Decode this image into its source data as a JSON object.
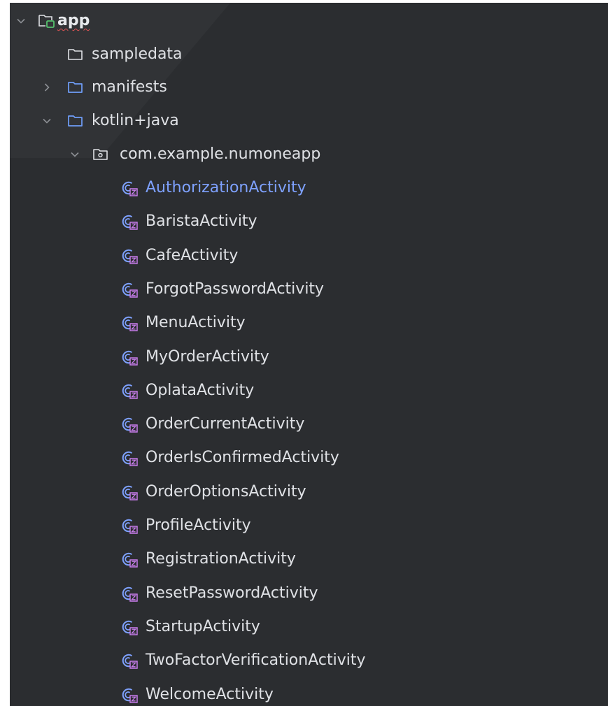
{
  "tree": {
    "root": {
      "label": "app",
      "expanded": true,
      "icon": "android-module-icon"
    },
    "sampledata": {
      "label": "sampledata",
      "icon": "folder-icon"
    },
    "manifests": {
      "label": "manifests",
      "expanded": false,
      "icon": "folder-icon"
    },
    "source_root": {
      "label": "kotlin+java",
      "expanded": true,
      "icon": "source-folder-icon"
    },
    "package": {
      "label": "com.example.numoneapp",
      "expanded": true,
      "icon": "package-icon"
    },
    "classes": [
      {
        "label": "AuthorizationActivity",
        "icon": "kotlin-class-icon",
        "selected": true
      },
      {
        "label": "BaristaActivity",
        "icon": "kotlin-class-icon"
      },
      {
        "label": "CafeActivity",
        "icon": "kotlin-class-icon"
      },
      {
        "label": "ForgotPasswordActivity",
        "icon": "kotlin-class-icon"
      },
      {
        "label": "MenuActivity",
        "icon": "kotlin-class-icon"
      },
      {
        "label": "MyOrderActivity",
        "icon": "kotlin-class-icon"
      },
      {
        "label": "OplataActivity",
        "icon": "kotlin-class-icon"
      },
      {
        "label": "OrderCurrentActivity",
        "icon": "kotlin-class-icon"
      },
      {
        "label": "OrderIsConfirmedActivity",
        "icon": "kotlin-class-icon"
      },
      {
        "label": "OrderOptionsActivity",
        "icon": "kotlin-class-icon"
      },
      {
        "label": "ProfileActivity",
        "icon": "kotlin-class-icon"
      },
      {
        "label": "RegistrationActivity",
        "icon": "kotlin-class-icon"
      },
      {
        "label": "ResetPasswordActivity",
        "icon": "kotlin-class-icon"
      },
      {
        "label": "StartupActivity",
        "icon": "kotlin-class-icon"
      },
      {
        "label": "TwoFactorVerificationActivity",
        "icon": "kotlin-class-icon"
      },
      {
        "label": "WelcomeActivity",
        "icon": "kotlin-class-icon"
      }
    ]
  },
  "colors": {
    "background": "#2b2d30",
    "text": "#dfe1e5",
    "selected_text": "#7ea1ff",
    "folder_blue": "#6f9ef8",
    "module_green": "#55c16d",
    "class_blue": "#7ea1ff",
    "class_purple": "#c77dea",
    "chevron": "#8c8f94"
  }
}
